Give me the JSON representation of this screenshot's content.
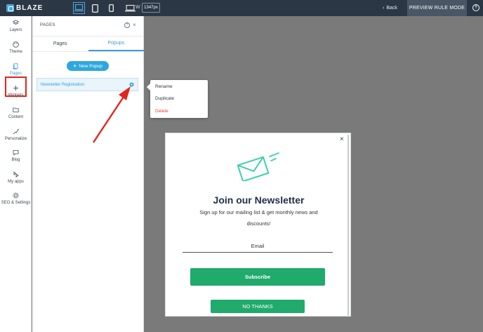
{
  "topbar": {
    "logo_text": "BLAZE",
    "width_label": "W",
    "width_value": "1347px",
    "back_label": "Back",
    "preview_label": "PREVIEW RULE MODE",
    "help_glyph": "?"
  },
  "rail": {
    "items": [
      {
        "label": "Layers",
        "icon": "layers-icon"
      },
      {
        "label": "Theme",
        "icon": "palette-icon"
      },
      {
        "label": "Pages",
        "icon": "pages-icon"
      },
      {
        "label": "Widgets",
        "icon": "plus-icon"
      },
      {
        "label": "Content",
        "icon": "folder-icon"
      },
      {
        "label": "Personalize",
        "icon": "personalize-icon"
      },
      {
        "label": "Blog",
        "icon": "chat-icon"
      },
      {
        "label": "My apps",
        "icon": "apps-icon"
      },
      {
        "label": "SEO & Settings",
        "icon": "gear-icon"
      }
    ],
    "active_item": "Pages",
    "accent": "#3f9bd6",
    "highlight_color": "#e3241c"
  },
  "panel": {
    "title": "PAGES",
    "tabs": [
      {
        "label": "Pages"
      },
      {
        "label": "Popups"
      }
    ],
    "active_tab": "Popups",
    "new_popup_label": "New Popup",
    "popups": [
      {
        "label": "Newsletter Registration"
      }
    ]
  },
  "context_menu": {
    "items": [
      {
        "label": "Rename"
      },
      {
        "label": "Duplicate"
      },
      {
        "label": "Delete"
      }
    ]
  },
  "newsletter": {
    "title": "Join our Newsletter",
    "subtitle_line1": "Sign up for our mailing list & get monthly news and",
    "subtitle_line2": "discounts!",
    "email_placeholder": "Email",
    "subscribe_label": "Subscribe",
    "no_thanks_label": "NO THANKS",
    "close_glyph": "×",
    "button_color": "#20aa6c",
    "icon_color": "#3ecfb0"
  },
  "annotation": {
    "arrow_color": "#e3241c"
  }
}
